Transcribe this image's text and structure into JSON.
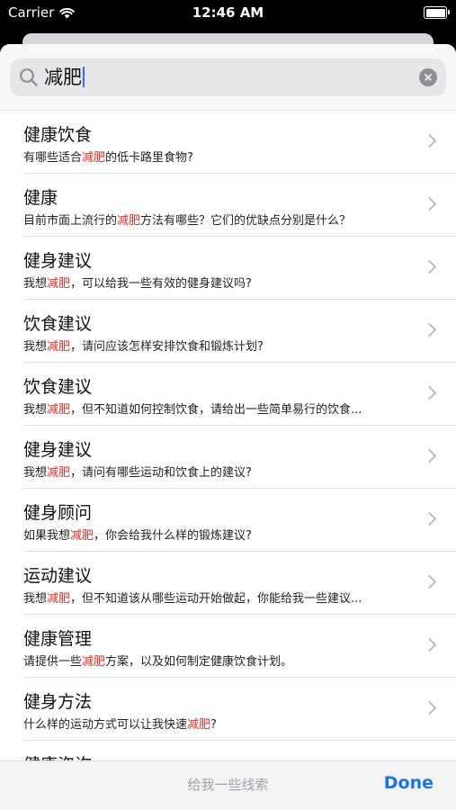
{
  "status_bar": {
    "carrier": "Carrier",
    "time": "12:46 AM"
  },
  "search": {
    "value": "减肥"
  },
  "rows": [
    {
      "title": "健康饮食",
      "pre": "有哪些适合",
      "hl": "减肥",
      "post": "的低卡路里食物?"
    },
    {
      "title": "健康",
      "pre": "目前市面上流行的",
      "hl": "减肥",
      "post": "方法有哪些？它们的优缺点分别是什么？"
    },
    {
      "title": "健身建议",
      "pre": "我想",
      "hl": "减肥",
      "post": "，可以给我一些有效的健身建议吗?"
    },
    {
      "title": "饮食建议",
      "pre": "我想",
      "hl": "减肥",
      "post": "，请问应该怎样安排饮食和锻炼计划?"
    },
    {
      "title": "饮食建议",
      "pre": "我想",
      "hl": "减肥",
      "post": "，但不知道如何控制饮食，请给出一些简单易行的饮食..."
    },
    {
      "title": "健身建议",
      "pre": "我想",
      "hl": "减肥",
      "post": "，请问有哪些运动和饮食上的建议?"
    },
    {
      "title": "健身顾问",
      "pre": "如果我想",
      "hl": "减肥",
      "post": "，你会给我什么样的锻炼建议?"
    },
    {
      "title": "运动建议",
      "pre": "我想",
      "hl": "减肥",
      "post": "，但不知道该从哪些运动开始做起，你能给我一些建议..."
    },
    {
      "title": "健康管理",
      "pre": "请提供一些",
      "hl": "减肥",
      "post": "方案，以及如何制定健康饮食计划。"
    },
    {
      "title": "健身方法",
      "pre": "什么样的运动方式可以让我快速",
      "hl": "减肥",
      "post": "?"
    },
    {
      "title": "健康咨询",
      "pre": "",
      "hl": "",
      "post": ""
    }
  ],
  "toolbar": {
    "hint": "给我一些线索",
    "done_label": "Done"
  },
  "colors": {
    "highlight": "#e43029",
    "accent": "#1a73e8"
  }
}
